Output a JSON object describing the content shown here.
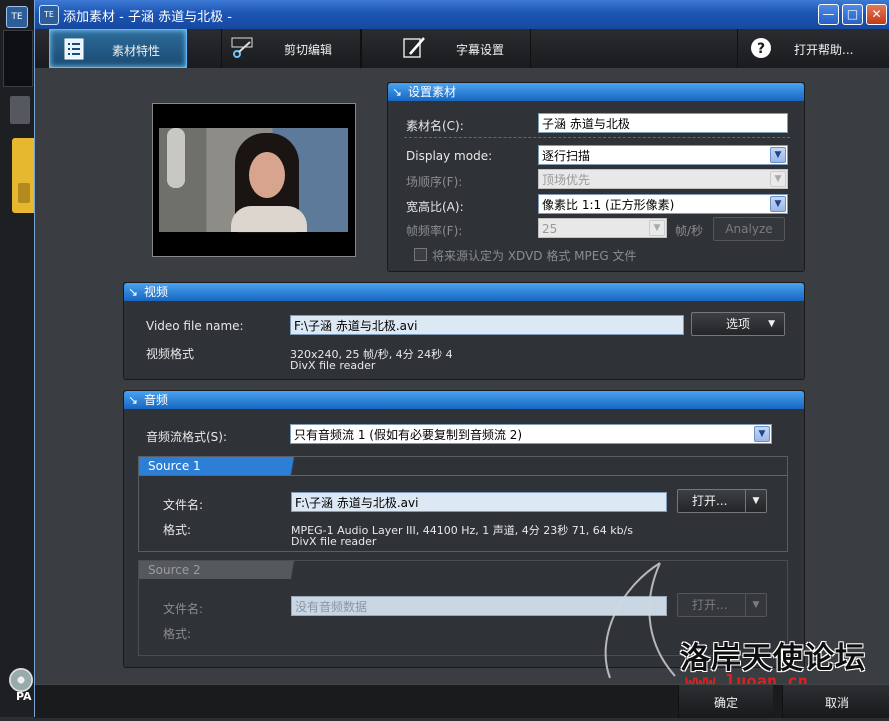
{
  "window": {
    "title": "添加素材 - 子涵 赤道与北极 -",
    "app_icon": "TE"
  },
  "toolbar": {
    "tabs": [
      {
        "label": "素材特性",
        "icon": "properties-icon"
      },
      {
        "label": "剪切编辑",
        "icon": "scissors-icon"
      },
      {
        "label": "字幕设置",
        "icon": "subtitle-pen-icon"
      }
    ],
    "help": {
      "label": "打开帮助...",
      "icon": "help-icon"
    }
  },
  "settings": {
    "header": "设置素材",
    "name_label": "素材名(C):",
    "name_value": "子涵 赤道与北极",
    "display_mode_label": "Display mode:",
    "display_mode_value": "逐行扫描",
    "field_order_label": "场顺序(F):",
    "field_order_value": "顶场优先",
    "aspect_label": "宽高比(A):",
    "aspect_value": "像素比 1:1 (正方形像素)",
    "framerate_label": "帧频率(F):",
    "framerate_value": "25",
    "framerate_unit": "帧/秒",
    "analyze_label": "Analyze",
    "xdvd_label": "将来源认定为 XDVD 格式 MPEG 文件"
  },
  "video": {
    "header": "视频",
    "file_label": "Video file name:",
    "file_value": "F:\\子涵 赤道与北极.avi",
    "options_label": "选项",
    "format_label": "视频格式",
    "format_line1": "320x240, 25 帧/秒, 4分 24秒 4",
    "format_line2": "DivX file reader"
  },
  "audio": {
    "header": "音频",
    "stream_label": "音频流格式(S):",
    "stream_value": "只有音频流 1 (假如有必要复制到音频流 2)",
    "source1": {
      "tab": "Source 1",
      "file_label": "文件名:",
      "file_value": "F:\\子涵 赤道与北极.avi",
      "open_label": "打开...",
      "format_label": "格式:",
      "format_line1": "MPEG-1 Audio Layer III, 44100 Hz, 1 声道, 4分 23秒 71, 64 kb/s",
      "format_line2": "DivX file reader"
    },
    "source2": {
      "tab": "Source 2",
      "file_label": "文件名:",
      "file_placeholder": "没有音频数据",
      "open_label": "打开...",
      "format_label": "格式:"
    }
  },
  "footer": {
    "ok_label": "确定",
    "cancel_label": "取消"
  },
  "background_app": {
    "badge": "PA"
  },
  "watermark": {
    "text": "洛岸天使论坛",
    "url": "www.luoan.cn"
  },
  "colors": {
    "accent": "#1e73d2",
    "title_bar": "#1c55b4",
    "active_tab_glow": "#5fb8ff"
  }
}
